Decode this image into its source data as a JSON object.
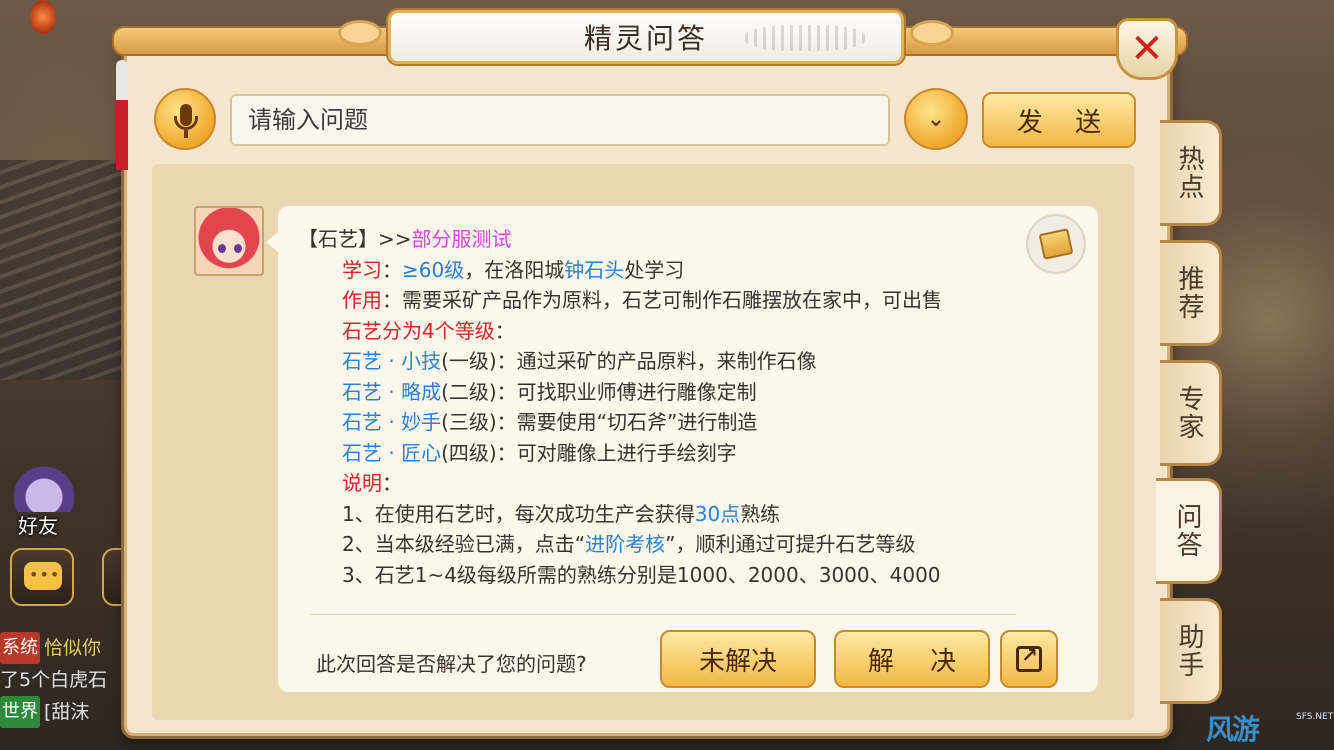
{
  "window": {
    "title": "精灵问答"
  },
  "search": {
    "placeholder": "请输入问题",
    "send_label": "发 送"
  },
  "answer": {
    "header_tag": "【石艺】",
    "header_sep": ">>",
    "header_link": "部分服测试",
    "learn_label": "学习",
    "learn_colon": "：",
    "learn_level": "≥60级",
    "learn_mid": "，在洛阳城",
    "learn_npc": "钟石头",
    "learn_end": "处学习",
    "use_label": "作用",
    "use_text": "：需要采矿产品作为原料，石艺可制作石雕摆放在家中，可出售",
    "levels_title": "石艺分为4个等级",
    "levels_colon": "：",
    "levels": [
      {
        "name": "石艺 · 小技",
        "rank": "(一级)：通过采矿的产品原料，来制作石像"
      },
      {
        "name": "石艺 · 略成",
        "rank": "(二级)：可找职业师傅进行雕像定制"
      },
      {
        "name": "石艺 · 妙手",
        "rank": "(三级)：需要使用“切石斧”进行制造"
      },
      {
        "name": "石艺 · 匠心",
        "rank": "(四级)：可对雕像上进行手绘刻字"
      }
    ],
    "note_label": "说明",
    "note_colon": "：",
    "note1_a": "1、在使用石艺时，每次成功生产会获得",
    "note1_b": "30点",
    "note1_c": "熟练",
    "note2_a": "2、当本级经验已满，点击“",
    "note2_b": "进阶考核",
    "note2_c": "”，顺利通过可提升石艺等级",
    "note3": "3、石艺1~4级每级所需的熟练分别是1000、2000、3000、4000"
  },
  "feedback": {
    "question": "此次回答是否解决了您的问题?",
    "unsolved_label": "未解决",
    "solved_label": "解 决"
  },
  "tabs": [
    {
      "label": "热点"
    },
    {
      "label": "推荐"
    },
    {
      "label": "专家"
    },
    {
      "label": "问答",
      "active": true
    },
    {
      "label": "助手"
    }
  ],
  "hud": {
    "friend_label": "好友",
    "chat": [
      {
        "tag": "系统",
        "text": "恰似你"
      },
      {
        "tag": "",
        "text": "了5个白虎石"
      },
      {
        "tag": "世界",
        "text": "[甜沫"
      }
    ]
  },
  "watermark": {
    "text": "游",
    "small": "SFS.NET"
  },
  "colors": {
    "accent_gold": "#f2b844",
    "red": "#d7262a",
    "blue": "#2a7fd6",
    "pink": "#d64bd6"
  }
}
